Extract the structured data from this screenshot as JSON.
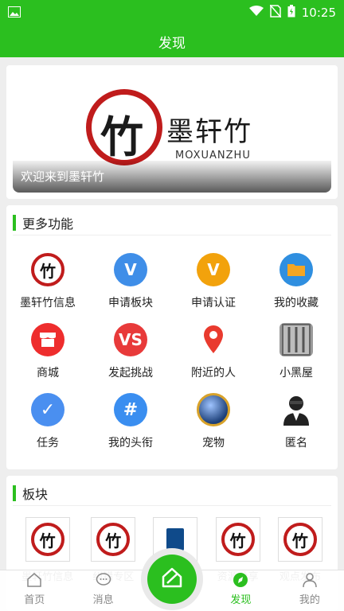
{
  "status_bar": {
    "time": "10:25"
  },
  "header": {
    "title": "发现"
  },
  "banner": {
    "logo_char": "竹",
    "title": "墨轩竹",
    "subtitle": "MOXUANZHU",
    "caption": "欢迎来到墨轩竹"
  },
  "features": {
    "title": "更多功能",
    "items": [
      {
        "label": "墨轩竹信息",
        "icon": "moxuanzhu-logo-icon",
        "glyph": "竹",
        "color": "#ffffff"
      },
      {
        "label": "申请板块",
        "icon": "v-blue-icon",
        "glyph": "V",
        "color": "#3f8ee8"
      },
      {
        "label": "申请认证",
        "icon": "v-orange-icon",
        "glyph": "V",
        "color": "#f2a20c"
      },
      {
        "label": "我的收藏",
        "icon": "folder-icon",
        "glyph": "",
        "color": "#2f8fe0"
      },
      {
        "label": "商城",
        "icon": "shop-icon",
        "glyph": "",
        "color": "#ee2d2d"
      },
      {
        "label": "发起挑战",
        "icon": "vs-icon",
        "glyph": "VS",
        "color": "#e83a3a"
      },
      {
        "label": "附近的人",
        "icon": "location-pin-icon",
        "glyph": "",
        "color": "#ffffff"
      },
      {
        "label": "小黑屋",
        "icon": "jail-icon",
        "glyph": "",
        "color": "#9a9a9a"
      },
      {
        "label": "任务",
        "icon": "task-check-icon",
        "glyph": "✓",
        "color": "#4a8ff0"
      },
      {
        "label": "我的头衔",
        "icon": "hashtag-icon",
        "glyph": "#",
        "color": "#3a8ef0"
      },
      {
        "label": "宠物",
        "icon": "pet-ball-icon",
        "glyph": "",
        "color": "#3d6fb0"
      },
      {
        "label": "匿名",
        "icon": "anonymous-icon",
        "glyph": "",
        "color": "#ffffff"
      }
    ]
  },
  "boards": {
    "title": "板块",
    "items": [
      {
        "label": "墨轩竹信息",
        "icon": "moxuanzhu-logo-icon"
      },
      {
        "label": "纠错专区",
        "icon": "moxuanzhu-logo-icon"
      },
      {
        "label": "书库",
        "icon": "bookstore-icon"
      },
      {
        "label": "资源分享",
        "icon": "moxuanzhu-logo-icon"
      },
      {
        "label": "观点发布",
        "icon": "moxuanzhu-logo-icon"
      }
    ]
  },
  "bottom_nav": {
    "items": [
      {
        "label": "首页",
        "icon": "home-icon",
        "active": false
      },
      {
        "label": "消息",
        "icon": "message-icon",
        "active": false
      },
      {
        "label": "",
        "icon": "post-edit-icon",
        "active": false
      },
      {
        "label": "发现",
        "icon": "discover-compass-icon",
        "active": true
      },
      {
        "label": "我的",
        "icon": "profile-icon",
        "active": false
      }
    ]
  },
  "colors": {
    "primary": "#2bbf1f",
    "logo_red": "#c01c1c"
  }
}
